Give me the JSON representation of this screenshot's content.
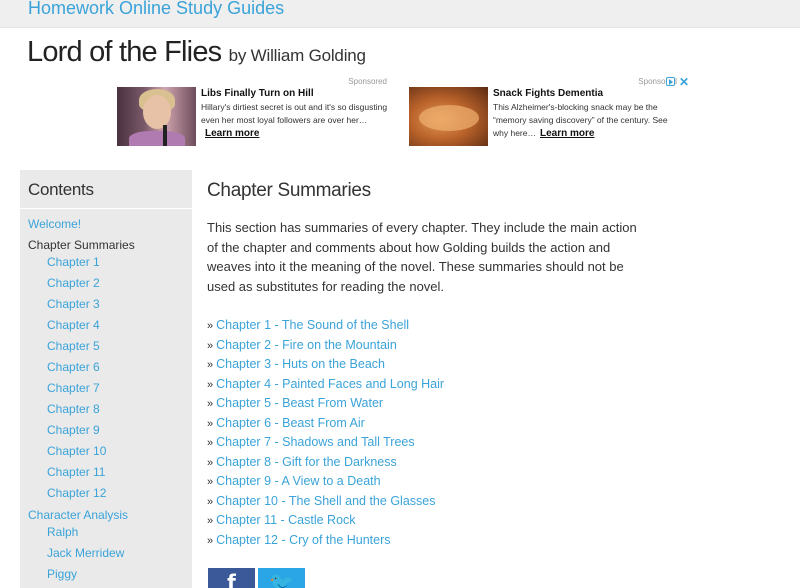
{
  "header": {
    "site_title": "Homework Online Study Guides",
    "book_title": "Lord of the Flies",
    "book_author": "by William Golding"
  },
  "ads": [
    {
      "sponsored": "Sponsored",
      "headline": "Libs Finally Turn on Hill",
      "body": "Hillary's dirtiest secret is out and it's so disgusting even her most loyal followers are over her…",
      "cta": "Learn more"
    },
    {
      "sponsored": "Sponsored",
      "headline": "Snack Fights Dementia",
      "body": "This Alzheimer's-blocking snack may be the “memory saving discovery” of the century. See why here…",
      "cta": "Learn more",
      "close": "✕"
    }
  ],
  "sidebar": {
    "heading": "Contents",
    "welcome": "Welcome!",
    "section_label": "Chapter Summaries",
    "chapters": [
      "Chapter 1",
      "Chapter 2",
      "Chapter 3",
      "Chapter 4",
      "Chapter 5",
      "Chapter 6",
      "Chapter 7",
      "Chapter 8",
      "Chapter 9",
      "Chapter 10",
      "Chapter 11",
      "Chapter 12"
    ],
    "character_analysis": "Character Analysis",
    "characters": [
      "Ralph",
      "Jack Merridew",
      "Piggy"
    ]
  },
  "main": {
    "heading": "Chapter Summaries",
    "intro": "This section has summaries of every chapter. They include the main action of the chapter and comments about how Golding builds the action and weaves into it the meaning of the novel. These summaries should not be used as substitutes for reading the novel.",
    "bullet": "»",
    "chapter_links": [
      "Chapter 1 - The Sound of the Shell",
      "Chapter 2 - Fire on the Mountain",
      "Chapter 3 - Huts on the Beach",
      "Chapter 4 - Painted Faces and Long Hair",
      "Chapter 5 - Beast From Water",
      "Chapter 6 - Beast From Air",
      "Chapter 7 - Shadows and Tall Trees",
      "Chapter 8 - Gift for the Darkness",
      "Chapter 9 - A View to a Death",
      "Chapter 10 - The Shell and the Glasses",
      "Chapter 11 - Castle Rock",
      "Chapter 12 - Cry of the Hunters"
    ]
  },
  "share": {
    "facebook_glyph": "f",
    "twitter_glyph": "🐦"
  },
  "colors": {
    "link": "#3aa3d9",
    "sidebar_bg": "#eaeaea",
    "facebook": "#3b5998",
    "twitter": "#2aa6e6"
  }
}
